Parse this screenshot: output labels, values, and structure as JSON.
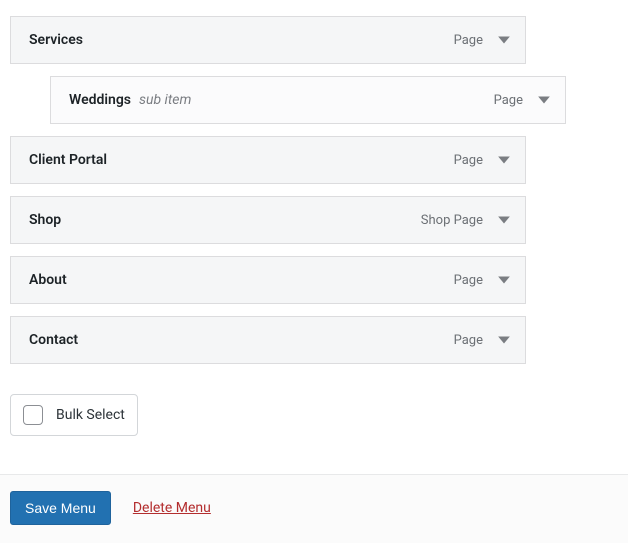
{
  "menu_items": [
    {
      "title": "Services",
      "type": "Page",
      "depth": 0,
      "sub": false
    },
    {
      "title": "Weddings",
      "type": "Page",
      "depth": 1,
      "sub": true
    },
    {
      "title": "Client Portal",
      "type": "Page",
      "depth": 0,
      "sub": false
    },
    {
      "title": "Shop",
      "type": "Shop Page",
      "depth": 0,
      "sub": false
    },
    {
      "title": "About",
      "type": "Page",
      "depth": 0,
      "sub": false
    },
    {
      "title": "Contact",
      "type": "Page",
      "depth": 0,
      "sub": false
    }
  ],
  "sub_item_label": "sub item",
  "bulk_select_label": "Bulk Select",
  "save_label": "Save Menu",
  "delete_label": "Delete Menu"
}
